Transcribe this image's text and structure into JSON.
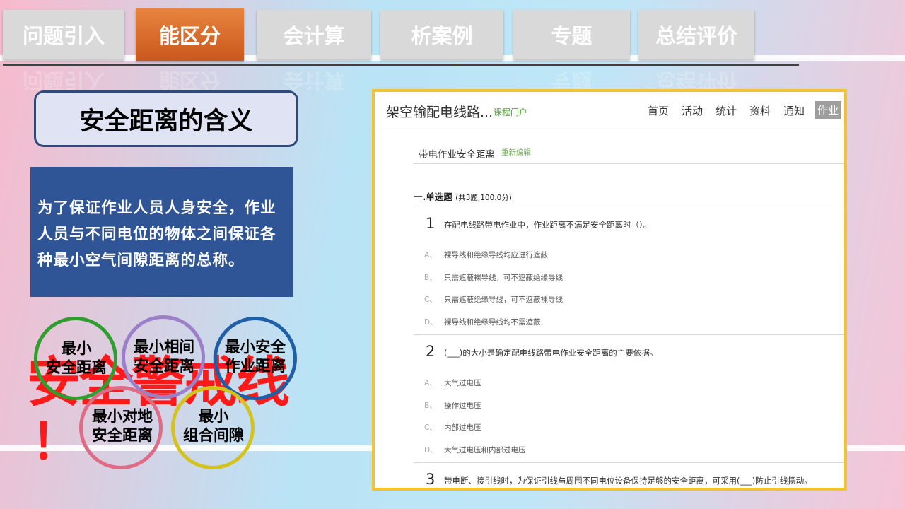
{
  "tabs": [
    {
      "label": "问题引入",
      "active": false
    },
    {
      "label": "能区分",
      "active": true
    },
    {
      "label": "会计算",
      "active": false
    },
    {
      "label": "析案例",
      "active": false
    },
    {
      "label": "专题",
      "active": false
    },
    {
      "label": "总结评价",
      "active": false
    }
  ],
  "left": {
    "title": "安全距离的含义",
    "definition": "为了保证作业人员人身安全，作业人员与不同电位的物体之间保证各种最小空气间隙距离的总称。",
    "warning": "安全警戒线",
    "exclaim": "！",
    "circles": [
      {
        "line1": "最小",
        "line2": "安全距离",
        "color": "#2e9e2e"
      },
      {
        "line1": "最小相间",
        "line2": "安全距离",
        "color": "#9b7fc7"
      },
      {
        "line1": "最小安全",
        "line2": "作业距离",
        "color": "#1f5fa8"
      },
      {
        "line1": "最小对地",
        "line2": "安全距离",
        "color": "#e06b86"
      },
      {
        "line1": "最小",
        "line2": "组合间隙",
        "color": "#d4c21f"
      }
    ]
  },
  "panel": {
    "course_title": "架空输配电线路...",
    "portal_link": "课程门户",
    "nav": [
      "首页",
      "活动",
      "统计",
      "资料",
      "通知",
      "作业"
    ],
    "nav_active": "作业",
    "homework_title": "带电作业安全距离",
    "reedit": "重新编辑",
    "section_title": "一.单选题",
    "section_meta": "(共3题,100.0分)",
    "questions": [
      {
        "num": "1",
        "text": "在配电线路带电作业中，作业距离不满足安全距离时（）。",
        "options": [
          {
            "label": "A、",
            "text": "裸导线和绝缘导线均应进行遮蔽"
          },
          {
            "label": "B、",
            "text": "只需遮蔽裸导线，可不遮蔽绝缘导线"
          },
          {
            "label": "C、",
            "text": "只需遮蔽绝缘导线，可不遮蔽裸导线"
          },
          {
            "label": "D、",
            "text": "裸导线和绝缘导线均不需遮蔽"
          }
        ]
      },
      {
        "num": "2",
        "text": "(___)的大小是确定配电线路带电作业安全距离的主要依据。",
        "options": [
          {
            "label": "A、",
            "text": "大气过电压"
          },
          {
            "label": "B、",
            "text": "操作过电压"
          },
          {
            "label": "C、",
            "text": "内部过电压"
          },
          {
            "label": "D、",
            "text": "大气过电压和内部过电压"
          }
        ]
      },
      {
        "num": "3",
        "text": "带电断、接引线时，为保证引线与周围不同电位设备保持足够的安全距离，可采用(___)防止引线摆动。",
        "options": []
      }
    ]
  }
}
